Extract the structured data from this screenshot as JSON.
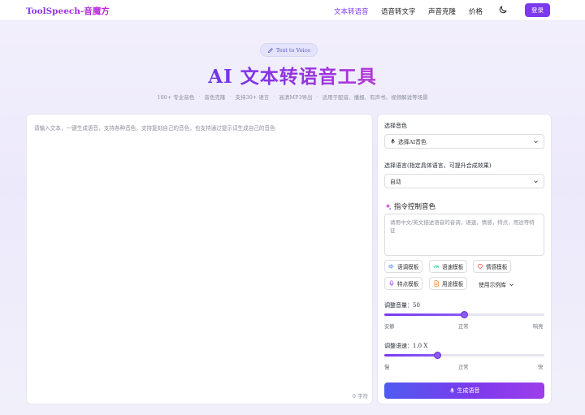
{
  "nav": {
    "brand": "ToolSpeech-音魔方",
    "links": [
      "文本转语音",
      "语音转文字",
      "声音克隆",
      "价格"
    ],
    "active_link": "文本转语音",
    "login": "登录",
    "theme_icon": "moon-icon"
  },
  "hero": {
    "badge": "Text to Voice",
    "badge_icon": "pen-icon",
    "title": "AI 文本转语音工具",
    "features": [
      "100+ 专业音色",
      "音色克隆",
      "支持30+ 语言",
      "高清MP3导出",
      "适用于配音、播报、有声书、视频解说等场景"
    ]
  },
  "editor": {
    "placeholder": "请输入文本，一键生成语音，支持各种音色，支持复刻自己的音色，也支持通过提示词生成自己的音色",
    "char_count": "0 字符"
  },
  "settings": {
    "voice_label": "选择音色",
    "voice_value": "选择AI音色",
    "language_label": "选择语言(指定具体语言，可提升合成效果)",
    "language_value": "自动",
    "instruction_title": "指令控制音色",
    "instruction_placeholder": "请用中文/英文描述语音的音调，语速，情感，特点，用途等特征",
    "templates": [
      {
        "label": "语调模板",
        "icon": "volume-icon"
      },
      {
        "label": "语速模板",
        "icon": "gauge-icon"
      },
      {
        "label": "情感模板",
        "icon": "heart-icon"
      },
      {
        "label": "特点模板",
        "icon": "mic-icon"
      },
      {
        "label": "用途模板",
        "icon": "document-icon"
      }
    ],
    "examples_label": "使用示例库",
    "volume": {
      "label": "调整音量：50",
      "value": 50,
      "min": 0,
      "max": 100,
      "scale": [
        "安静",
        "正常",
        "响亮"
      ]
    },
    "speed": {
      "label": "调整语速：1.0 X",
      "value": 1.0,
      "min": 0.5,
      "max": 2.0,
      "scale": [
        "慢",
        "正常",
        "快"
      ]
    },
    "generate": "生成语音"
  },
  "colors": {
    "accent": "#7c3aed",
    "accent_pink": "#c026d3",
    "button_blue": "#4f5bf0"
  }
}
